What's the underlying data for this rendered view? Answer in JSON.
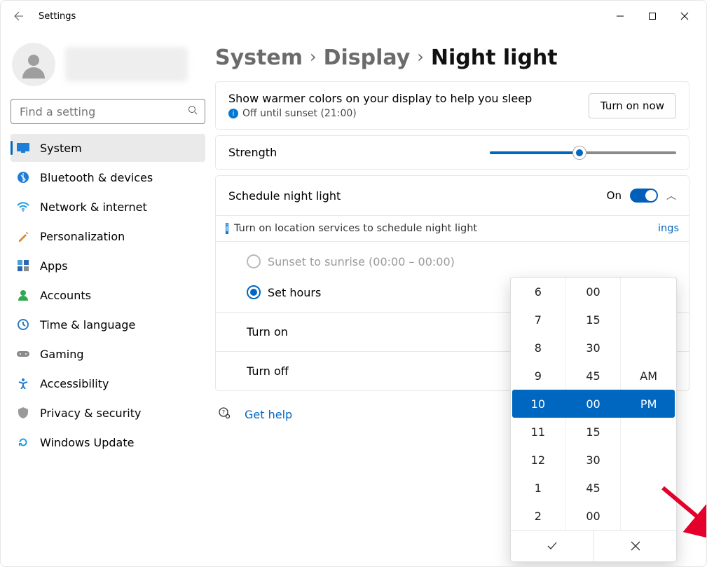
{
  "window": {
    "title": "Settings"
  },
  "search": {
    "placeholder": "Find a setting"
  },
  "sidebar": {
    "items": [
      {
        "label": "System"
      },
      {
        "label": "Bluetooth & devices"
      },
      {
        "label": "Network & internet"
      },
      {
        "label": "Personalization"
      },
      {
        "label": "Apps"
      },
      {
        "label": "Accounts"
      },
      {
        "label": "Time & language"
      },
      {
        "label": "Gaming"
      },
      {
        "label": "Accessibility"
      },
      {
        "label": "Privacy & security"
      },
      {
        "label": "Windows Update"
      }
    ]
  },
  "crumbs": {
    "a": "System",
    "b": "Display",
    "c": "Night light"
  },
  "topcard": {
    "title": "Show warmer colors on your display to help you sleep",
    "status": "Off until sunset (21:00)",
    "button": "Turn on now"
  },
  "strength": {
    "label": "Strength",
    "value": 48
  },
  "schedule": {
    "title": "Schedule night light",
    "toggle_label": "On",
    "infobar": "Turn on location services to schedule night light",
    "link_fragment": "ings",
    "option_sunset": "Sunset to sunrise (00:00 – 00:00)",
    "option_sethours": "Set hours",
    "turn_on": "Turn on",
    "turn_off": "Turn off"
  },
  "help": {
    "label": "Get help"
  },
  "timepicker": {
    "hours": [
      "6",
      "7",
      "8",
      "9",
      "10",
      "11",
      "12",
      "1",
      "2"
    ],
    "minutes": [
      "00",
      "15",
      "30",
      "45",
      "00",
      "15",
      "30",
      "45",
      "00"
    ],
    "ampm": [
      "",
      "",
      "",
      "AM",
      "PM",
      "",
      "",
      "",
      ""
    ],
    "selected": {
      "hour": "10",
      "minute": "00",
      "ampm": "PM"
    }
  }
}
